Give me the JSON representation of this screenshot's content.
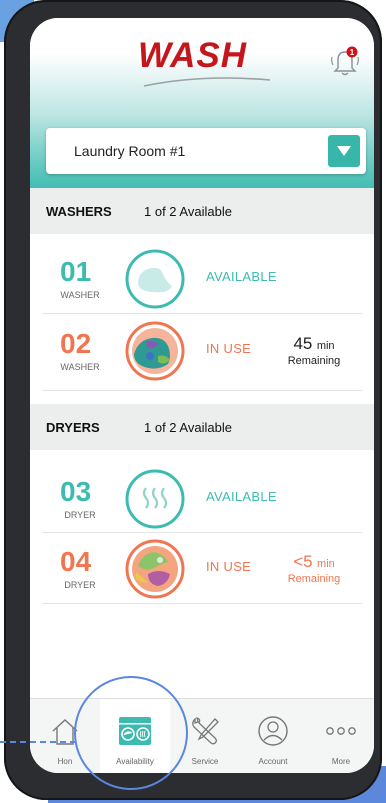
{
  "app": {
    "logo": "WASH",
    "notification_badge": "1"
  },
  "room_select": {
    "value": "Laundry Room #1"
  },
  "washers": {
    "title": "WASHERS",
    "count": "1 of 2 Available",
    "machines": [
      {
        "number": "01",
        "type": "WASHER",
        "status": "AVAILABLE",
        "time": "",
        "unit": "",
        "remaining": ""
      },
      {
        "number": "02",
        "type": "WASHER",
        "status": "IN USE",
        "time": "45",
        "unit": "min",
        "remaining": "Remaining"
      }
    ]
  },
  "dryers": {
    "title": "DRYERS",
    "count": "1 of 2 Available",
    "machines": [
      {
        "number": "03",
        "type": "DRYER",
        "status": "AVAILABLE",
        "time": "",
        "unit": "",
        "remaining": ""
      },
      {
        "number": "04",
        "type": "DRYER",
        "status": "IN USE",
        "time": "<5",
        "unit": "min",
        "remaining": "Remaining"
      }
    ]
  },
  "tabs": [
    {
      "label": "Hon",
      "icon": "home-icon"
    },
    {
      "label": "Availability",
      "icon": "availability-icon"
    },
    {
      "label": "Service",
      "icon": "wrench-screwdriver-icon"
    },
    {
      "label": "Account",
      "icon": "account-icon"
    },
    {
      "label": "More",
      "icon": "more-dots-icon"
    }
  ],
  "colors": {
    "brand_red": "#c4161c",
    "teal": "#3dbbb0",
    "orange": "#f07651",
    "highlight_blue": "#5b88dd"
  }
}
